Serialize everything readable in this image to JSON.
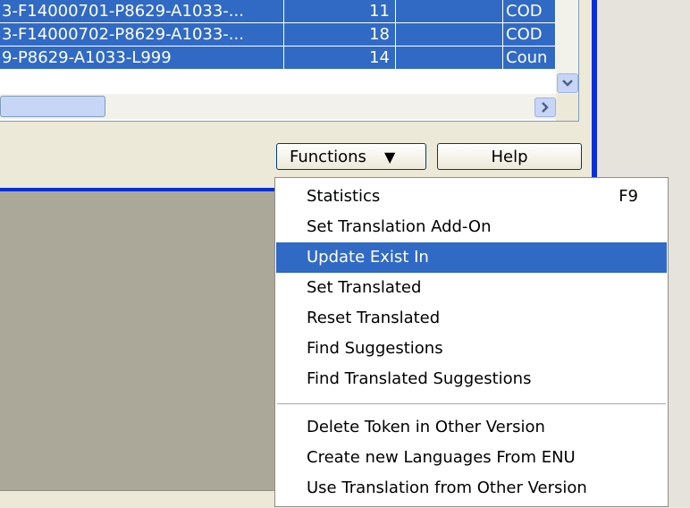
{
  "grid": {
    "rows": [
      {
        "name": "3-F14000701-P8629-A1033-...",
        "count": "11",
        "type": "COD"
      },
      {
        "name": "3-F14000702-P8629-A1033-...",
        "count": "18",
        "type": "COD"
      },
      {
        "name": "9-P8629-A1033-L999",
        "count": "14",
        "type": "Coun"
      }
    ]
  },
  "buttons": {
    "functions_label": "Functions",
    "help_label": "Help"
  },
  "menu": {
    "items": [
      {
        "label": "Statistics",
        "shortcut": "F9"
      },
      {
        "label": "Set Translation Add-On",
        "shortcut": ""
      },
      {
        "label": "Update Exist In",
        "shortcut": ""
      },
      {
        "label": "Set Translated",
        "shortcut": ""
      },
      {
        "label": "Reset Translated",
        "shortcut": ""
      },
      {
        "label": "Find Suggestions",
        "shortcut": ""
      },
      {
        "label": "Find Translated Suggestions",
        "shortcut": ""
      },
      {
        "label": "Delete Token in Other Version",
        "shortcut": ""
      },
      {
        "label": "Create new Languages From ENU",
        "shortcut": ""
      },
      {
        "label": "Use Translation from Other Version",
        "shortcut": ""
      }
    ],
    "selected_label": "Update Exist In"
  },
  "icons": {
    "scroll_down": "chevron-down-icon",
    "scroll_right": "chevron-right-icon",
    "dropdown": "caret-down-icon"
  },
  "colors": {
    "selection": "#316ac5",
    "window_border": "#0a2fd6",
    "face": "#ece9d8"
  }
}
